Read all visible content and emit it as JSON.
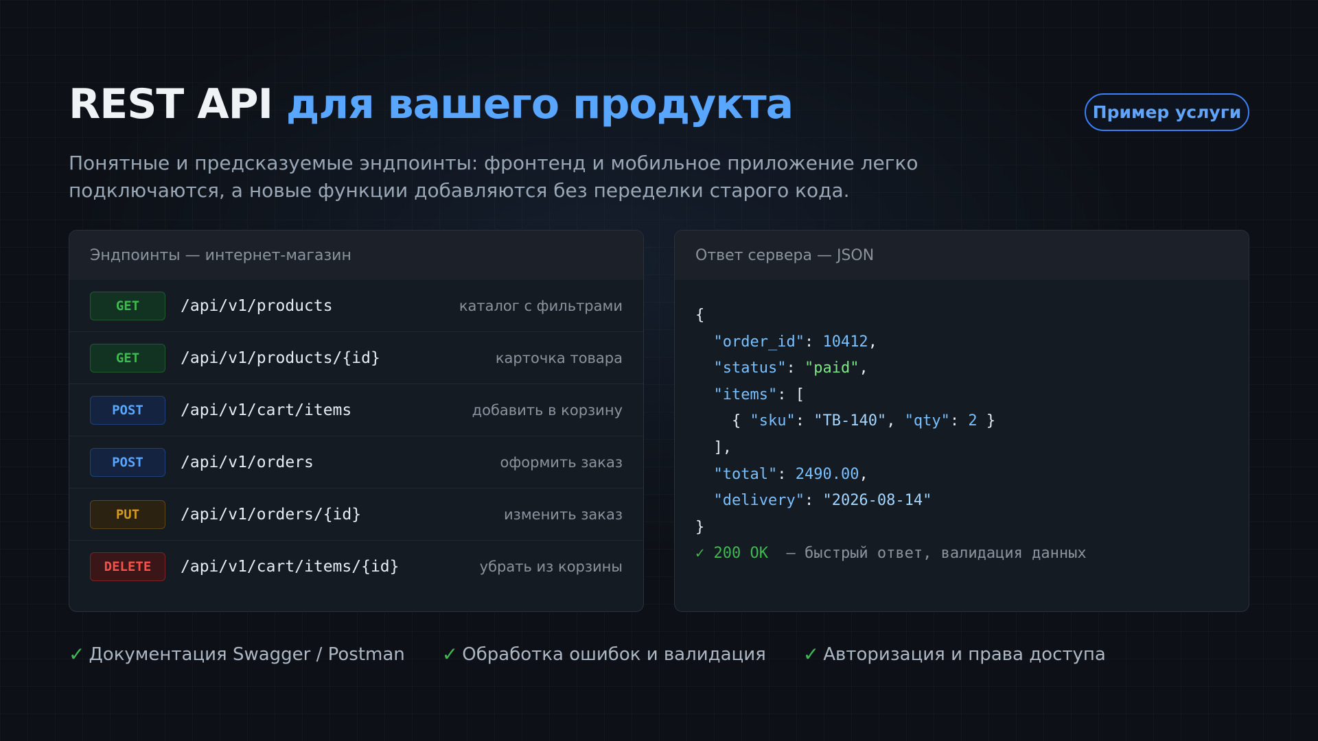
{
  "header": {
    "title_part1": "REST API",
    "title_part2": "для вашего продукта",
    "subtitle": "Понятные и предсказуемые эндпоинты: фронтенд и мобильное приложение легко подключаются, а новые функции добавляются без переделки старого кода.",
    "cta_label": "Пример услуги"
  },
  "endpoints_card": {
    "title": "Эндпоинты — интернет-магазин",
    "rows": [
      {
        "method": "GET",
        "path": "/api/v1/products",
        "desc": "каталог с фильтрами"
      },
      {
        "method": "GET",
        "path": "/api/v1/products/{id}",
        "desc": "карточка товара"
      },
      {
        "method": "POST",
        "path": "/api/v1/cart/items",
        "desc": "добавить в корзину"
      },
      {
        "method": "POST",
        "path": "/api/v1/orders",
        "desc": "оформить заказ"
      },
      {
        "method": "PUT",
        "path": "/api/v1/orders/{id}",
        "desc": "изменить заказ"
      },
      {
        "method": "DELETE",
        "path": "/api/v1/cart/items/{id}",
        "desc": "убрать из корзины"
      }
    ]
  },
  "json_card": {
    "title": "Ответ сервера — JSON",
    "order_id_key": "\"order_id\"",
    "order_id_val": "10412",
    "status_key": "\"status\"",
    "status_val": "\"paid\"",
    "items_key": "\"items\"",
    "sku_key": "\"sku\"",
    "sku_val": "\"TB-140\"",
    "qty_key": "\"qty\"",
    "qty_val": "2",
    "total_key": "\"total\"",
    "total_val": "2490.00",
    "delivery_key": "\"delivery\"",
    "delivery_val": "\"2026-08-14\"",
    "status_line_ok": "✓ 200 OK",
    "status_line_note": "— быстрый ответ, валидация данных"
  },
  "features": [
    "Документация Swagger / Postman",
    "Обработка ошибок и валидация",
    "Авторизация и права доступа"
  ],
  "colors": {
    "accent": "#58a6ff",
    "get": "#3fb950",
    "post": "#58a6ff",
    "put": "#d29922",
    "delete": "#f85149"
  }
}
